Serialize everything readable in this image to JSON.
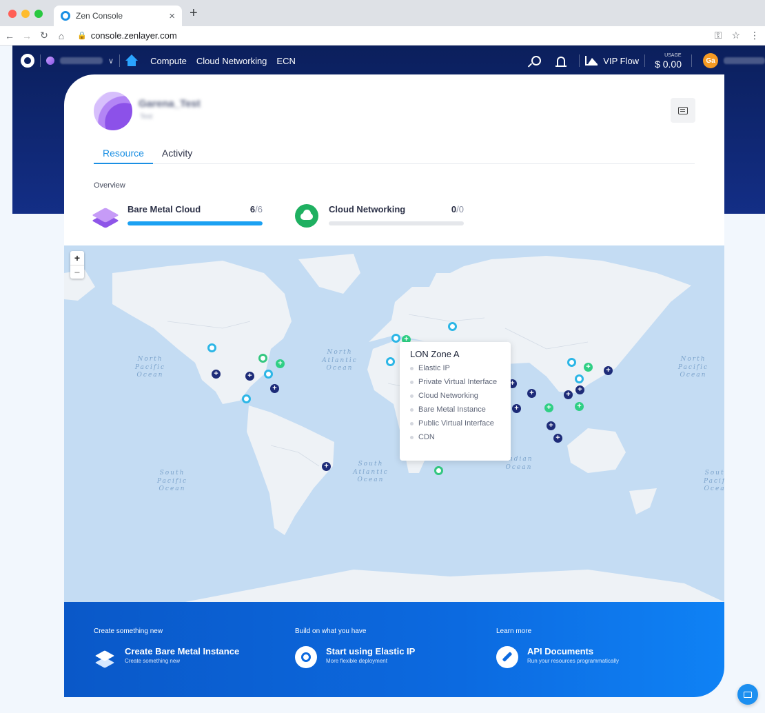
{
  "browser": {
    "tab_title": "Zen Console",
    "url": "console.zenlayer.com"
  },
  "nav": {
    "links": [
      "Compute",
      "Cloud Networking",
      "ECN"
    ],
    "vip_flow": "VIP Flow",
    "usage_label": "USAGE",
    "usage_value": "$ 0.00",
    "avatar_initials": "Ga"
  },
  "profile": {
    "name": "Garena_Test",
    "role": "Test"
  },
  "tabs": [
    "Resource",
    "Activity"
  ],
  "overview": {
    "label": "Overview",
    "resources": [
      {
        "name": "Bare Metal Cloud",
        "count": "6",
        "total": "/6",
        "fill": 1.0
      },
      {
        "name": "Cloud Networking",
        "count": "0",
        "total": "/0",
        "fill": 0.0
      }
    ]
  },
  "map": {
    "oceans": {
      "north_pacific_left": "North Pacific Ocean",
      "north_atlantic": "North Atlantic Ocean",
      "north_pacific_right": "North Pacific Ocean",
      "south_pacific_left": "South Pacific Ocean",
      "south_atlantic": "South Atlantic Ocean",
      "indian": "Indian Ocean",
      "south_pacific_right": "South Pacific Ocean"
    },
    "popup": {
      "title": "LON Zone A",
      "items": [
        "Elastic IP",
        "Private Virtual Interface",
        "Cloud Networking",
        "Bare Metal Instance",
        "Public Virtual Interface",
        "CDN"
      ]
    }
  },
  "footer": {
    "columns": [
      {
        "heading": "Create something new",
        "title": "Create Bare Metal Instance",
        "subtitle": "Create something new"
      },
      {
        "heading": "Build on what you have",
        "title": "Start using Elastic IP",
        "subtitle": "More flexible deployment"
      },
      {
        "heading": "Learn more",
        "title": "API Documents",
        "subtitle": "Run your resources programmatically"
      }
    ]
  }
}
